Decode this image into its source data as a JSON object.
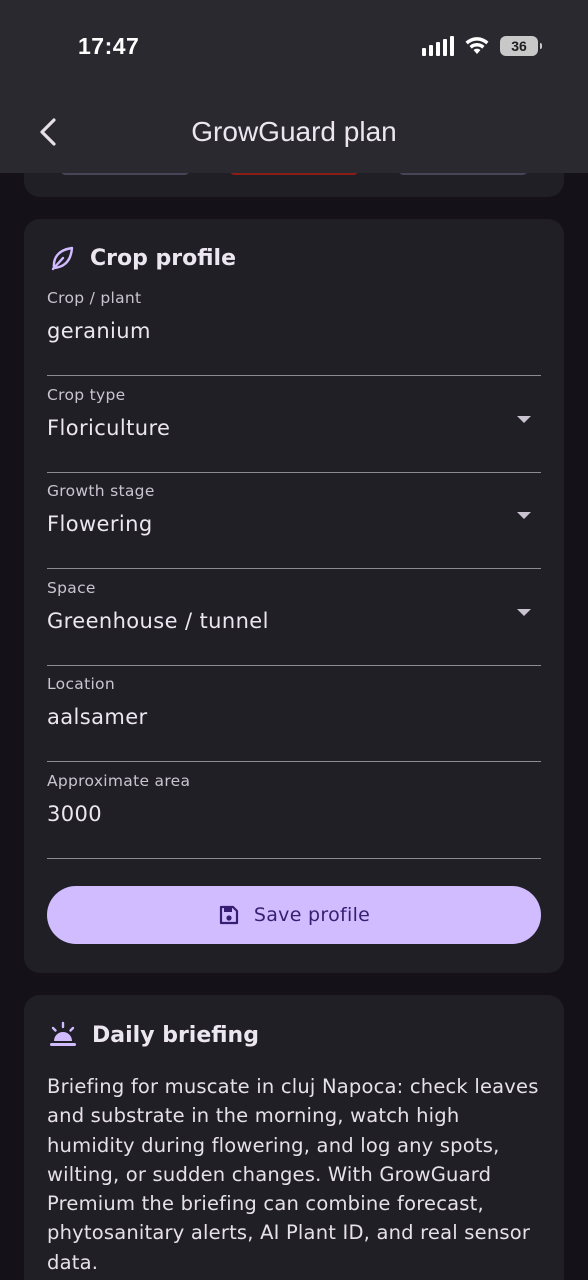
{
  "status_bar": {
    "time": "17:47",
    "battery": "36"
  },
  "header": {
    "title": "GrowGuard plan",
    "back_icon": "chevron-left-icon"
  },
  "crop_profile": {
    "title": "Crop profile",
    "icon": "leaf-icon",
    "fields": [
      {
        "label": "Crop / plant",
        "value": "geranium",
        "type": "text"
      },
      {
        "label": "Crop type",
        "value": "Floriculture",
        "type": "dropdown"
      },
      {
        "label": "Growth stage",
        "value": "Flowering",
        "type": "dropdown"
      },
      {
        "label": "Space",
        "value": "Greenhouse / tunnel",
        "type": "dropdown"
      },
      {
        "label": "Location",
        "value": "aalsamer",
        "type": "text"
      },
      {
        "label": "Approximate area",
        "value": "3000",
        "type": "text"
      }
    ],
    "save_label": "Save profile",
    "save_icon": "save-icon"
  },
  "daily_briefing": {
    "title": "Daily briefing",
    "icon": "sunrise-icon",
    "text": "Briefing for muscate in cluj Napoca: check leaves and substrate in the morning, watch high humidity during flowering, and log any spots, wilting, or sudden changes. With GrowGuard Premium the briefing can combine forecast, phytosanitary alerts, AI Plant ID, and real sensor data."
  },
  "colors": {
    "background": "#141218",
    "card": "#211f26",
    "header": "#2b2930",
    "accent": "#d0bcff",
    "on_accent": "#381e72"
  }
}
